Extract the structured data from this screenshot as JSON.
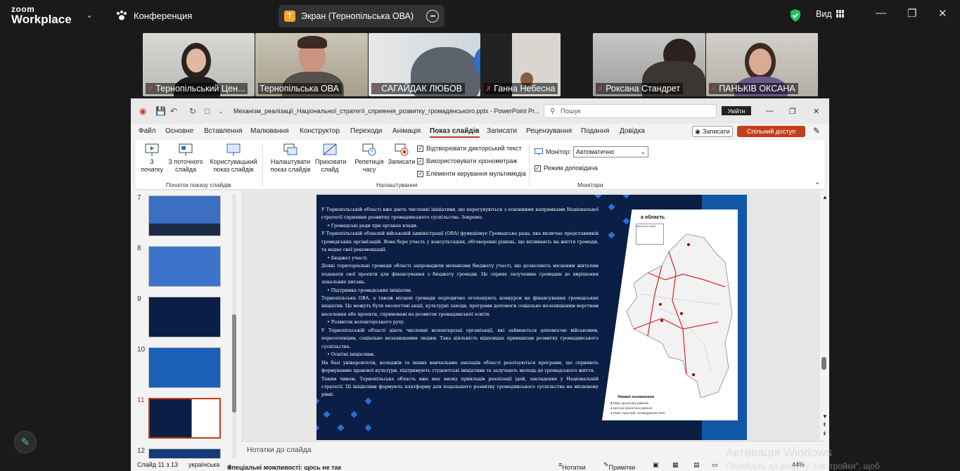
{
  "zoom": {
    "logo_line1": "zoom",
    "logo_line2": "Workplace",
    "meeting_label": "Конференция",
    "screen_share_badge": "T",
    "screen_share_label": "Экран (Тернопільська ОВА)",
    "view_label": "Вид"
  },
  "participants": [
    {
      "name": "Тернопільський Цен..."
    },
    {
      "name": "Тернопільська ОВА"
    },
    {
      "name": "САГАЙДАК ЛЮБОВ"
    },
    {
      "name": "Ганна Небесна"
    },
    {
      "name": "Роксана Стандрет"
    },
    {
      "name": "ПАНЬКІВ ОКСАНА"
    }
  ],
  "ppt": {
    "file_title": "Механізм_реалізації_Національної_стратегії_сприяння_розвитку_громадянського.pptx - PowerPoint Pr...",
    "search_placeholder": "Пошук",
    "signin": "Увійти",
    "menu": [
      "Файл",
      "Основне",
      "Вставлення",
      "Малювання",
      "Конструктор",
      "Переходи",
      "Анімація",
      "Показ слайдів",
      "Записати",
      "Рецензування",
      "Подання",
      "Довідка"
    ],
    "active_menu": "Показ слайдів",
    "record_btn": "Записати",
    "share_btn": "Спільний доступ",
    "ribbon": {
      "from_start": "З початку",
      "from_current": "З поточного слайда",
      "custom_show": "Користувацький показ слайдів",
      "group_start": "Початок показу слайдів",
      "setup_show": "Налаштувати показ слайдів",
      "hide_slide": "Приховати слайд",
      "rehearse": "Репетиція часу",
      "record": "Записати",
      "play_narrations": "Відтворювати дикторський текст",
      "use_timings": "Використовувати хронометраж",
      "media_controls": "Елементи керування мультимедіа",
      "group_setup": "Налаштування",
      "monitor_label": "Монітор:",
      "monitor_value": "Автоматично",
      "presenter_view": "Режим доповідача",
      "group_monitors": "Монітори"
    },
    "thumb_numbers": [
      "7",
      "8",
      "9",
      "10",
      "11",
      "12"
    ],
    "notes_placeholder": "Нотатки до слайда",
    "status": {
      "slide_of": "Слайд 11 з 13",
      "language": "українська",
      "accessibility": "Спеціальні можливості: щось не так",
      "notes": "Нотатки",
      "comments": "Примітки",
      "zoom": "44%"
    }
  },
  "slide": {
    "paragraphs": [
      {
        "bullet": false,
        "text": "У Тернопільській області вже діють численні ініціативи, що перегукуються з основними напрямками Національної стратегії сприяння розвитку громадянського суспільства. Зокрема:"
      },
      {
        "bullet": true,
        "text": "Громадські ради при органах влади."
      },
      {
        "bullet": false,
        "text": "У Тернопільській обласній військовій адміністрації (ОВА) функціонує Громадська рада, яка включає представників громадських організацій. Вона бере участь у консультаціях, обговоренні рішень, що впливають на життя громади, та надає свої рекомендації."
      },
      {
        "bullet": true,
        "text": "Бюджет участі."
      },
      {
        "bullet": false,
        "text": "Деякі територіальні громади області запровадили механізми бюджету участі, що дозволяють місцевим жителям подавати свої проєкти для фінансування з бюджету громади. Це сприяє залученню громадян до вирішення локальних питань."
      },
      {
        "bullet": true,
        "text": "Підтримка громадських ініціатив."
      },
      {
        "bullet": false,
        "text": "Тернопільська ОВА, а також місцеві громади періодично оголошують конкурси на фінансування громадських ініціатив. Це можуть бути екологічні акції, культурні заходи, програми допомоги соціально незахищеним верствам населення або проєкти, спрямовані на розвиток громадянської освіти."
      },
      {
        "bullet": true,
        "text": "Розвиток волонтерського руху."
      },
      {
        "bullet": false,
        "text": "У Тернопільській області діють численні волонтерські організації, які займаються допомогою військовим, переселенцям, соціально незахищеним людям. Така діяльність відповідає принципам розвитку громадянського суспільства."
      },
      {
        "bullet": true,
        "text": "Освітні ініціативи."
      },
      {
        "bullet": false,
        "text": "На базі університетів, коледжів та інших навчальних закладів області реалізуються програми, що сприяють формуванню правової культури, підтримують студентські ініціативи та залучають молодь до громадського життя."
      },
      {
        "bullet": false,
        "text": "Таким чином, Тернопільська область вже має низку прикладів реалізації ідей, закладених у Національній стратегії. Ці ініціативи формують платформу для подальшого розвитку громадянського суспільства на місцевому рівні."
      }
    ],
    "map_title": "а область",
    "map_table_header": "ення (тис.осіб)",
    "legend_title": "Умовні позначення",
    "legend_items": [
      "Межі проектних районів",
      "Центри проектних районів",
      "Межі територій, затверджених КМУ"
    ]
  },
  "windows": {
    "activate_line1": "Активація Windows",
    "activate_line2": "Перейдіть до розділу \"Настройки\", щоб"
  },
  "colors": {
    "zoom_bg": "#1a1a1a",
    "active_speaker": "#23d96b",
    "ppt_accent": "#c43e1c",
    "slide_bg": "#0b1e45",
    "slide_band": "#1257a7"
  }
}
